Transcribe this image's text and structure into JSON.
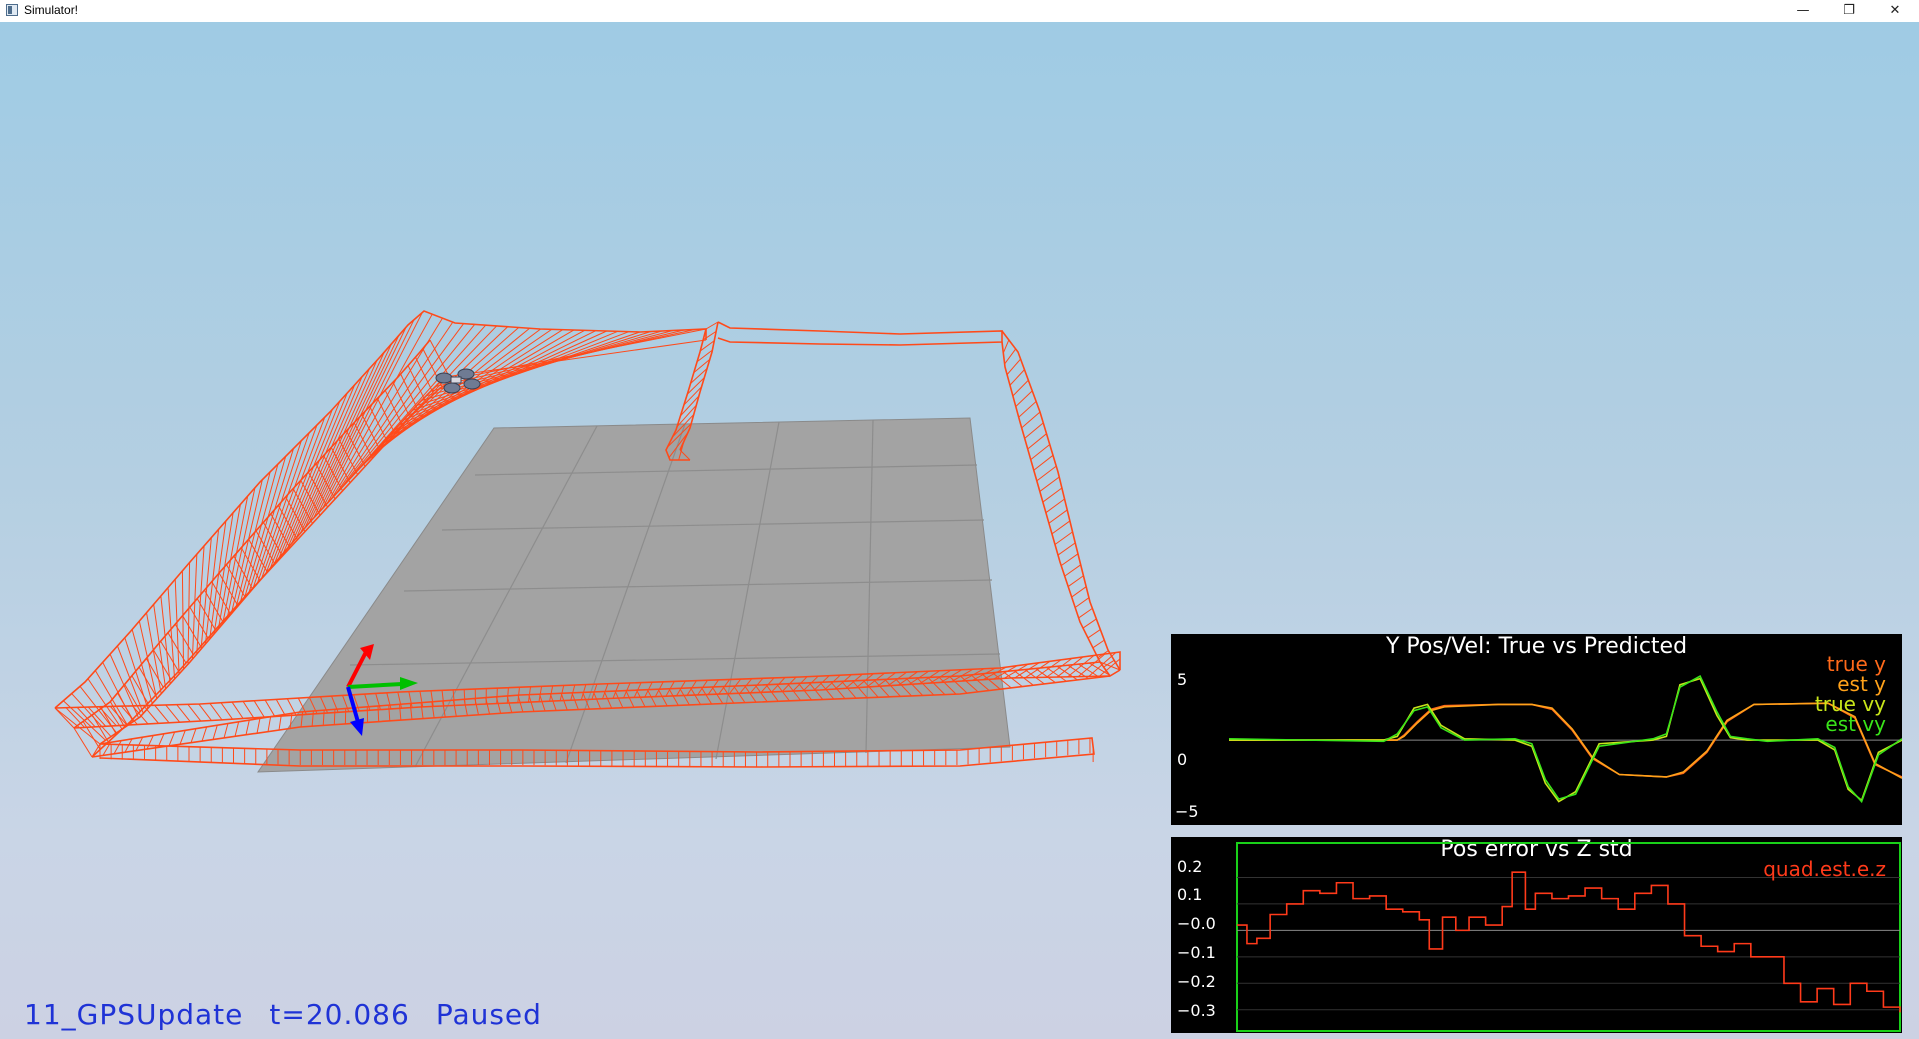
{
  "window": {
    "title": "Simulator!",
    "controls": {
      "minimize": "—",
      "restore": "❐",
      "close": "✕"
    }
  },
  "status": {
    "scenario": "11_GPSUpdate",
    "time": "t=20.086",
    "state": "Paused"
  },
  "colors": {
    "trail": "#ff5a2a",
    "status_text": "#1f33d6",
    "ground": "#a3a3a3",
    "axis_x": "#ff0000",
    "axis_y": "#00c000",
    "axis_z": "#0000ff"
  },
  "chart_data": [
    {
      "type": "line",
      "title": "Y Pos/Vel: True vs Predicted",
      "ylim": [
        -6.5,
        7
      ],
      "yticks": [
        "5",
        "0",
        "−5"
      ],
      "xlim": [
        0,
        20
      ],
      "grid": false,
      "legend": "top-right",
      "series": [
        {
          "name": "true y",
          "color": "#ff6a1a",
          "x": [
            0,
            5,
            5.2,
            5.6,
            6.0,
            6.4,
            8.0,
            9.0,
            9.6,
            10.2,
            10.8,
            11.6,
            13.0,
            13.5,
            14.2,
            14.8,
            15.6,
            17.8,
            18.6,
            19.2,
            20
          ],
          "y": [
            0,
            0,
            0.4,
            1.5,
            2.5,
            2.8,
            2.9,
            2.9,
            2.5,
            0.8,
            -1.5,
            -2.8,
            -3.0,
            -2.7,
            -1.0,
            1.5,
            2.9,
            3.0,
            1.8,
            -2.0,
            -3.0
          ]
        },
        {
          "name": "est y",
          "color": "#ffa21a",
          "x": [
            0,
            5,
            5.2,
            5.6,
            6.0,
            6.4,
            8.0,
            9.0,
            9.6,
            10.2,
            10.8,
            11.6,
            13.0,
            13.5,
            14.2,
            14.8,
            15.6,
            17.8,
            18.6,
            19.2,
            20
          ],
          "y": [
            0,
            0,
            0.3,
            1.4,
            2.4,
            2.7,
            2.9,
            2.9,
            2.6,
            0.9,
            -1.4,
            -2.8,
            -3.0,
            -2.6,
            -0.9,
            1.6,
            2.9,
            3.0,
            1.9,
            -1.9,
            -3.1
          ]
        },
        {
          "name": "true vy",
          "color": "#c8e61a",
          "x": [
            0,
            4.6,
            5.0,
            5.5,
            5.9,
            6.3,
            7.0,
            8.5,
            9.0,
            9.4,
            9.8,
            10.3,
            11.0,
            12.6,
            13.0,
            13.4,
            14.0,
            14.5,
            14.9,
            15.4,
            16.0,
            17.5,
            18.0,
            18.4,
            18.8,
            19.3,
            20
          ],
          "y": [
            0,
            0,
            0.3,
            2.6,
            2.9,
            1.2,
            0.1,
            0,
            -0.5,
            -3.5,
            -5.0,
            -4.2,
            -0.3,
            0,
            0.3,
            4.5,
            5.0,
            2.0,
            0.2,
            0,
            0,
            0,
            -0.8,
            -4.0,
            -4.9,
            -1.0,
            0
          ]
        },
        {
          "name": "est vy",
          "color": "#3ae41a",
          "x": [
            0,
            4.6,
            5.0,
            5.5,
            5.9,
            6.3,
            7.0,
            8.5,
            9.0,
            9.4,
            9.8,
            10.3,
            11.0,
            12.6,
            13.0,
            13.4,
            14.0,
            14.5,
            14.9,
            15.4,
            16.0,
            17.5,
            18.0,
            18.4,
            18.8,
            19.3,
            20
          ],
          "y": [
            0.1,
            -0.1,
            0.5,
            2.4,
            2.7,
            1.0,
            0.0,
            0.1,
            -0.3,
            -3.2,
            -4.8,
            -4.4,
            -0.5,
            0.1,
            0.5,
            4.3,
            5.2,
            2.3,
            0.3,
            0.1,
            -0.1,
            0.1,
            -0.6,
            -3.8,
            -5.0,
            -1.2,
            0.1
          ]
        }
      ]
    },
    {
      "type": "line",
      "title": "Pos error vs Z std",
      "ylim": [
        -0.35,
        0.3
      ],
      "yticks": [
        "0.2",
        "0.1",
        "−0.0",
        "−0.1",
        "−0.2",
        "−0.3"
      ],
      "xlim": [
        0,
        20
      ],
      "grid": true,
      "legend": "top-right",
      "series": [
        {
          "name": "quad.est.e.z",
          "color": "#ff3a1a",
          "x": [
            0,
            0.3,
            0.6,
            1.0,
            1.5,
            2.0,
            2.5,
            3.0,
            3.5,
            4.0,
            4.5,
            5.0,
            5.5,
            5.8,
            6.2,
            6.6,
            7.0,
            7.5,
            8.0,
            8.3,
            8.7,
            9.0,
            9.5,
            10.0,
            10.5,
            11.0,
            11.5,
            12.0,
            12.5,
            13.0,
            13.5,
            14.0,
            14.5,
            15.0,
            15.5,
            16.0,
            16.5,
            17.0,
            17.5,
            18.0,
            18.5,
            19.0,
            19.5,
            20
          ],
          "y": [
            0.02,
            -0.05,
            -0.03,
            0.06,
            0.1,
            0.15,
            0.14,
            0.18,
            0.12,
            0.13,
            0.08,
            0.07,
            0.04,
            -0.07,
            0.05,
            0.0,
            0.05,
            0.02,
            0.09,
            0.22,
            0.08,
            0.14,
            0.12,
            0.13,
            0.16,
            0.12,
            0.08,
            0.14,
            0.17,
            0.1,
            -0.02,
            -0.06,
            -0.08,
            -0.05,
            -0.1,
            -0.1,
            -0.2,
            -0.27,
            -0.22,
            -0.28,
            -0.2,
            -0.23,
            -0.29,
            -0.31
          ]
        }
      ]
    }
  ]
}
